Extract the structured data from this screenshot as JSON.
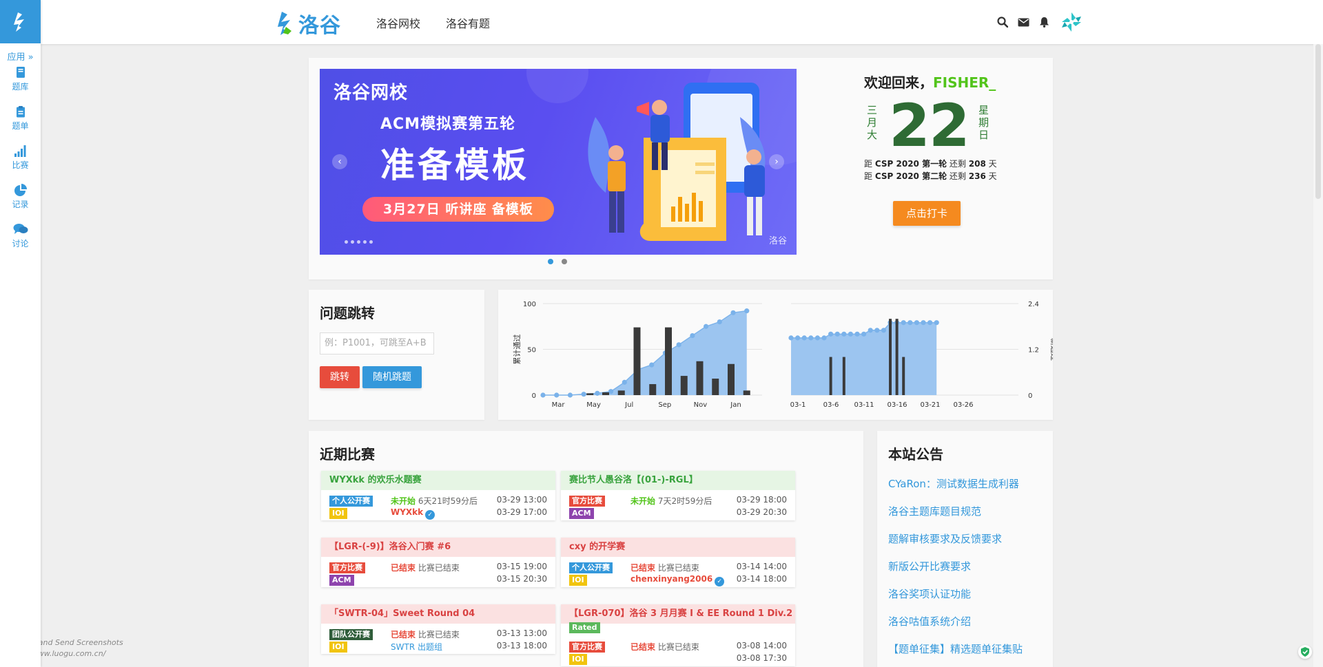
{
  "sidebar": {
    "apps_label": "应用 »",
    "items": [
      {
        "label": "题库",
        "icon": "book-icon"
      },
      {
        "label": "题单",
        "icon": "clipboard-icon"
      },
      {
        "label": "比赛",
        "icon": "bar-chart-icon"
      },
      {
        "label": "记录",
        "icon": "pie-chart-icon"
      },
      {
        "label": "讨论",
        "icon": "comments-icon"
      }
    ]
  },
  "header": {
    "brand": "洛谷",
    "nav": [
      "洛谷网校",
      "洛谷有题"
    ],
    "icons": [
      "search-icon",
      "mail-icon",
      "bell-icon"
    ]
  },
  "banner": {
    "logo_text": "洛谷网校",
    "subtitle": "ACM模拟赛第五轮",
    "headline": "准备模板",
    "pill": "3月27日  听讲座  备模板",
    "watermark": "洛谷",
    "prev": "‹",
    "next": "›"
  },
  "welcome": {
    "greeting": "欢迎回来，",
    "username": "FISHER_",
    "month": "三月大",
    "day": "22",
    "weekday": "星期日",
    "countdown": [
      {
        "prefix": "距",
        "event": "CSP 2020 第一轮",
        "mid": "还剩",
        "days": "208",
        "unit": "天"
      },
      {
        "prefix": "距",
        "event": "CSP 2020 第二轮",
        "mid": "还剩",
        "days": "236",
        "unit": "天"
      }
    ],
    "punch_button": "点击打卡"
  },
  "jump": {
    "title": "问题跳转",
    "placeholder": "例：P1001，可跳至A+B",
    "jump_button": "跳转",
    "random_button": "随机跳题"
  },
  "chart_data": [
    {
      "type": "bar",
      "ylabel": "累计通过",
      "ylim": [
        0,
        100
      ],
      "yticks": [
        0,
        50,
        100
      ],
      "x_labels": [
        "Mar",
        "May",
        "Jul",
        "Sep",
        "Nov",
        "Jan"
      ],
      "series": [
        {
          "type": "area",
          "values": [
            0,
            0,
            0,
            1,
            2,
            4,
            14,
            28,
            33,
            46,
            55,
            65,
            75,
            80,
            90,
            92
          ]
        },
        {
          "type": "bar",
          "values": [
            0,
            0,
            0,
            2,
            3,
            5,
            74,
            12,
            74,
            21,
            37,
            18,
            34,
            5
          ]
        }
      ]
    },
    {
      "type": "bar",
      "ylabel": "新通过",
      "ylim": [
        0,
        2.4
      ],
      "yticks": [
        0,
        1.2,
        2.4
      ],
      "x_labels": [
        "03-1",
        "03-6",
        "03-11",
        "03-16",
        "03-21",
        "03-26"
      ],
      "series": [
        {
          "type": "area",
          "values": [
            1.5,
            1.5,
            1.5,
            1.5,
            1.5,
            1.5,
            1.6,
            1.6,
            1.6,
            1.6,
            1.6,
            1.6,
            1.7,
            1.7,
            1.7,
            1.9,
            1.9,
            1.9,
            1.9,
            1.9,
            1.9,
            1.9,
            1.9
          ]
        },
        {
          "type": "bar",
          "values": [
            0,
            0,
            0,
            0,
            0,
            0,
            1,
            0,
            1,
            0,
            0,
            0,
            0,
            0,
            0,
            2,
            2,
            1,
            0,
            0,
            0,
            0,
            0
          ]
        }
      ]
    }
  ],
  "contests": {
    "title": "近期比赛",
    "items": [
      {
        "title": "WYXkk 的欢乐水题赛",
        "head_color": "green",
        "tag1": "个人公开赛",
        "tag1_color": "blue",
        "tag2": "IOI",
        "tag2_color": "yellow",
        "status": "未开始",
        "status_color": "green",
        "remain": "6天21时59分后",
        "host": "WYXkk",
        "host_style": "red",
        "verified": true,
        "start": "03-29 13:00",
        "end": "03-29 17:00"
      },
      {
        "title": "赛比节人愚谷洛【(01-)-RGL】",
        "head_color": "green",
        "tag1": "官方比赛",
        "tag1_color": "red",
        "tag2": "ACM",
        "tag2_color": "purple",
        "status": "未开始",
        "status_color": "green",
        "remain": "7天2时59分后",
        "host": "",
        "host_style": "red",
        "verified": false,
        "start": "03-29 18:00",
        "end": "03-29 20:30"
      },
      {
        "title": "【LGR-(-9)】洛谷入门赛 #6",
        "head_color": "red",
        "tag1": "官方比赛",
        "tag1_color": "red",
        "tag2": "ACM",
        "tag2_color": "purple",
        "status": "已结束",
        "status_color": "red",
        "remain": "比赛已结束",
        "host": "",
        "host_style": "red",
        "verified": false,
        "start": "03-15 19:00",
        "end": "03-15 20:30"
      },
      {
        "title": "cxy 的开学赛",
        "head_color": "red",
        "tag1": "个人公开赛",
        "tag1_color": "blue",
        "tag2": "IOI",
        "tag2_color": "yellow",
        "status": "已结束",
        "status_color": "red",
        "remain": "比赛已结束",
        "host": "chenxinyang2006",
        "host_style": "red",
        "verified": true,
        "start": "03-14 14:00",
        "end": "03-14 18:00"
      },
      {
        "title": "「SWTR-04」Sweet Round 04",
        "head_color": "red",
        "tag1": "团队公开赛",
        "tag1_color": "dark",
        "tag2": "IOI",
        "tag2_color": "yellow",
        "status": "已结束",
        "status_color": "red",
        "remain": "比赛已结束",
        "host": "SWTR 出题组",
        "host_style": "blue",
        "verified": false,
        "start": "03-13 13:00",
        "end": "03-13 18:00"
      },
      {
        "title": "【LGR-070】洛谷 3 月月赛 I & EE Round 1 Div.2",
        "head_color": "red",
        "rated": "Rated",
        "tag1": "官方比赛",
        "tag1_color": "red",
        "tag2": "IOI",
        "tag2_color": "yellow",
        "status": "已结束",
        "status_color": "red",
        "remain": "比赛已结束",
        "host": "",
        "host_style": "red",
        "verified": false,
        "start": "03-08 14:00",
        "end": "03-08 17:30"
      }
    ]
  },
  "notices": {
    "title": "本站公告",
    "items": [
      "CYaRon：测试数据生成利器",
      "洛谷主题库题目规范",
      "题解审核要求及反馈要求",
      "新版公开比赛要求",
      "洛谷奖项认证功能",
      "洛谷咕值系统介绍",
      "【题单征集】精选题单征集贴"
    ]
  },
  "extension": {
    "line1": "Explain and Send Screenshots",
    "line2": "http://www.luogu.com.cn/"
  },
  "colors": {
    "accent": "#3498db",
    "username": "#52c41a",
    "calendar": "#2e6b34",
    "punch": "#f58a1f",
    "chart_area": "#9cc5f0",
    "chart_bar": "#3a3a3a"
  }
}
